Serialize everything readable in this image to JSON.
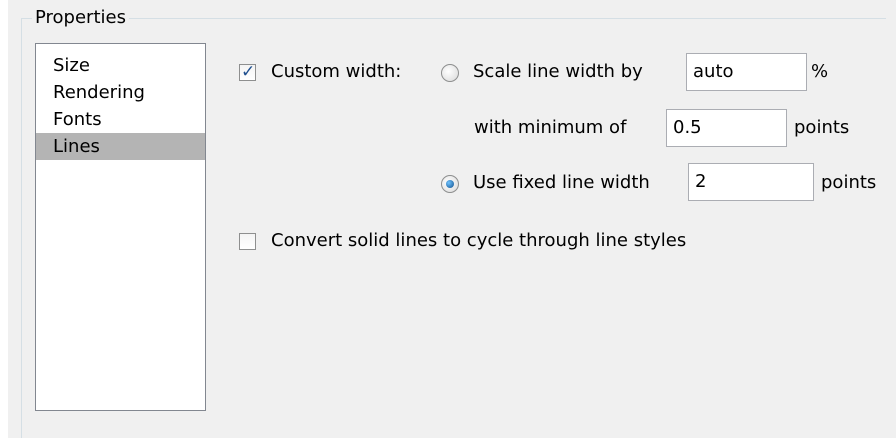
{
  "properties": {
    "title": "Properties",
    "nav_items": [
      {
        "label": "Size",
        "selected": false
      },
      {
        "label": "Rendering",
        "selected": false
      },
      {
        "label": "Fonts",
        "selected": false
      },
      {
        "label": "Lines",
        "selected": true
      }
    ]
  },
  "lines": {
    "custom_width": {
      "label": "Custom width:",
      "checked": true
    },
    "scale": {
      "label": "Scale line width by",
      "selected": false,
      "value": "auto",
      "unit": "%"
    },
    "minimum": {
      "label": "with minimum of",
      "value": "0.5",
      "unit": "points"
    },
    "fixed": {
      "label": "Use fixed line width",
      "selected": true,
      "value": "2",
      "unit": "points"
    },
    "convert": {
      "label": "Convert solid lines to cycle through line styles",
      "checked": false
    }
  },
  "colors": {
    "panel_bg": "#f0f0f0",
    "selection_bg": "#b4b4b4",
    "accent": "#1f7fd1"
  }
}
